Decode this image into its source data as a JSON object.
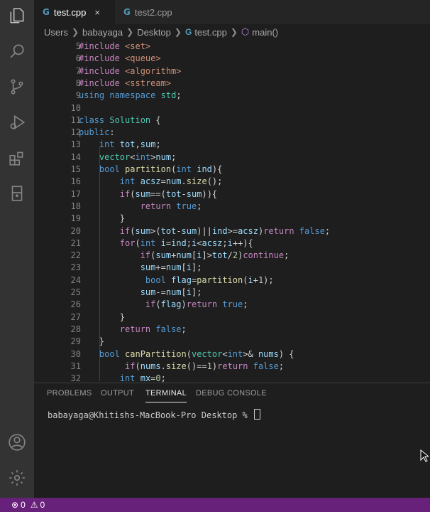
{
  "tabs": [
    {
      "label": "test.cpp",
      "icon": "cpp-file-icon",
      "active": true,
      "close": "×"
    },
    {
      "label": "test2.cpp",
      "icon": "cpp-file-icon",
      "active": false
    }
  ],
  "file_icon_glyph": "G",
  "breadcrumb": [
    "Users",
    "babayaga",
    "Desktop",
    "test.cpp",
    "main()"
  ],
  "editor": {
    "lines": [
      {
        "num": "5",
        "html": "<span style='color:#c586c0'>#include</span> <span style='color:#ce9178'>&lt;set&gt;</span>"
      },
      {
        "num": "6",
        "html": "<span style='color:#c586c0'>#include</span> <span style='color:#ce9178'>&lt;queue&gt;</span>"
      },
      {
        "num": "7",
        "html": "<span style='color:#c586c0'>#include</span> <span style='color:#ce9178'>&lt;algorithm&gt;</span>"
      },
      {
        "num": "8",
        "html": "<span style='color:#c586c0'>#include</span> <span style='color:#ce9178'>&lt;sstream&gt;</span>"
      },
      {
        "num": "9",
        "html": "<span style='color:#569cd6'>using</span> <span style='color:#569cd6'>namespace</span> <span style='color:#4ec9b0'>std</span>;"
      },
      {
        "num": "10",
        "html": ""
      },
      {
        "num": "11",
        "html": "<span style='color:#569cd6'>class</span> <span style='color:#4ec9b0'>Solution</span> {"
      },
      {
        "num": "12",
        "html": "<span style='color:#569cd6'>public</span>:"
      },
      {
        "num": "13",
        "html": "    <span style='color:#569cd6'>int</span> <span style='color:#9cdcfe'>tot</span>,<span style='color:#9cdcfe'>sum</span>;"
      },
      {
        "num": "14",
        "html": "    <span style='color:#4ec9b0'>vector</span>&lt;<span style='color:#569cd6'>int</span>&gt;<span style='color:#9cdcfe'>num</span>;"
      },
      {
        "num": "15",
        "html": "    <span style='color:#569cd6'>bool</span> <span style='color:#dcdcaa'>partition</span>(<span style='color:#569cd6'>int</span> <span style='color:#9cdcfe'>ind</span>){"
      },
      {
        "num": "16",
        "html": "        <span style='color:#569cd6'>int</span> <span style='color:#9cdcfe'>acsz</span>=<span style='color:#9cdcfe'>num</span>.<span style='color:#dcdcaa'>size</span>();"
      },
      {
        "num": "17",
        "html": "        <span style='color:#c586c0'>if</span>(<span style='color:#9cdcfe'>sum</span>==(<span style='color:#9cdcfe'>tot</span>-<span style='color:#9cdcfe'>sum</span>)){"
      },
      {
        "num": "18",
        "html": "            <span style='color:#c586c0'>return</span> <span style='color:#569cd6'>true</span>;"
      },
      {
        "num": "19",
        "html": "        }"
      },
      {
        "num": "20",
        "html": "        <span style='color:#c586c0'>if</span>(<span style='color:#9cdcfe'>sum</span>&gt;(<span style='color:#9cdcfe'>tot</span>-<span style='color:#9cdcfe'>sum</span>)||<span style='color:#9cdcfe'>ind</span>&gt;=<span style='color:#9cdcfe'>acsz</span>)<span style='color:#c586c0'>return</span> <span style='color:#569cd6'>false</span>;"
      },
      {
        "num": "21",
        "html": "        <span style='color:#c586c0'>for</span>(<span style='color:#569cd6'>int</span> <span style='color:#9cdcfe'>i</span>=<span style='color:#9cdcfe'>ind</span>;<span style='color:#9cdcfe'>i</span>&lt;<span style='color:#9cdcfe'>acsz</span>;<span style='color:#9cdcfe'>i</span>++){"
      },
      {
        "num": "22",
        "html": "            <span style='color:#c586c0'>if</span>(<span style='color:#9cdcfe'>sum</span>+<span style='color:#9cdcfe'>num</span>[<span style='color:#9cdcfe'>i</span>]&gt;<span style='color:#9cdcfe'>tot</span>/<span style='color:#b5cea8'>2</span>)<span style='color:#c586c0'>continue</span>;"
      },
      {
        "num": "23",
        "html": "            <span style='color:#9cdcfe'>sum</span>+=<span style='color:#9cdcfe'>num</span>[<span style='color:#9cdcfe'>i</span>];"
      },
      {
        "num": "24",
        "html": "             <span style='color:#569cd6'>bool</span> <span style='color:#9cdcfe'>flag</span>=<span style='color:#dcdcaa'>partition</span>(<span style='color:#9cdcfe'>i</span>+<span style='color:#b5cea8'>1</span>);"
      },
      {
        "num": "25",
        "html": "            <span style='color:#9cdcfe'>sum</span>-=<span style='color:#9cdcfe'>num</span>[<span style='color:#9cdcfe'>i</span>];"
      },
      {
        "num": "26",
        "html": "             <span style='color:#c586c0'>if</span>(<span style='color:#9cdcfe'>flag</span>)<span style='color:#c586c0'>return</span> <span style='color:#569cd6'>true</span>;"
      },
      {
        "num": "27",
        "html": "        }"
      },
      {
        "num": "28",
        "html": "        <span style='color:#c586c0'>return</span> <span style='color:#569cd6'>false</span>;"
      },
      {
        "num": "29",
        "html": "    }"
      },
      {
        "num": "30",
        "html": "    <span style='color:#569cd6'>bool</span> <span style='color:#dcdcaa'>canPartition</span>(<span style='color:#4ec9b0'>vector</span>&lt;<span style='color:#569cd6'>int</span>&gt;&amp; <span style='color:#9cdcfe'>nums</span>) {"
      },
      {
        "num": "31",
        "html": "         <span style='color:#c586c0'>if</span>(<span style='color:#9cdcfe'>nums</span>.<span style='color:#dcdcaa'>size</span>()==<span style='color:#b5cea8'>1</span>)<span style='color:#c586c0'>return</span> <span style='color:#569cd6'>false</span>;"
      },
      {
        "num": "32",
        "html": "        <span style='color:#569cd6'>int</span> <span style='color:#9cdcfe'>mx</span>=<span style='color:#b5cea8'>0</span>;"
      }
    ]
  },
  "panel": {
    "tabs": [
      "PROBLEMS",
      "OUTPUT",
      "TERMINAL",
      "DEBUG CONSOLE"
    ],
    "active_tab": "TERMINAL",
    "terminal_prompt": "babayaga@Khitishs-MacBook-Pro Desktop % "
  },
  "status": {
    "errors": "0",
    "warnings": "0",
    "color": "#68217a"
  }
}
